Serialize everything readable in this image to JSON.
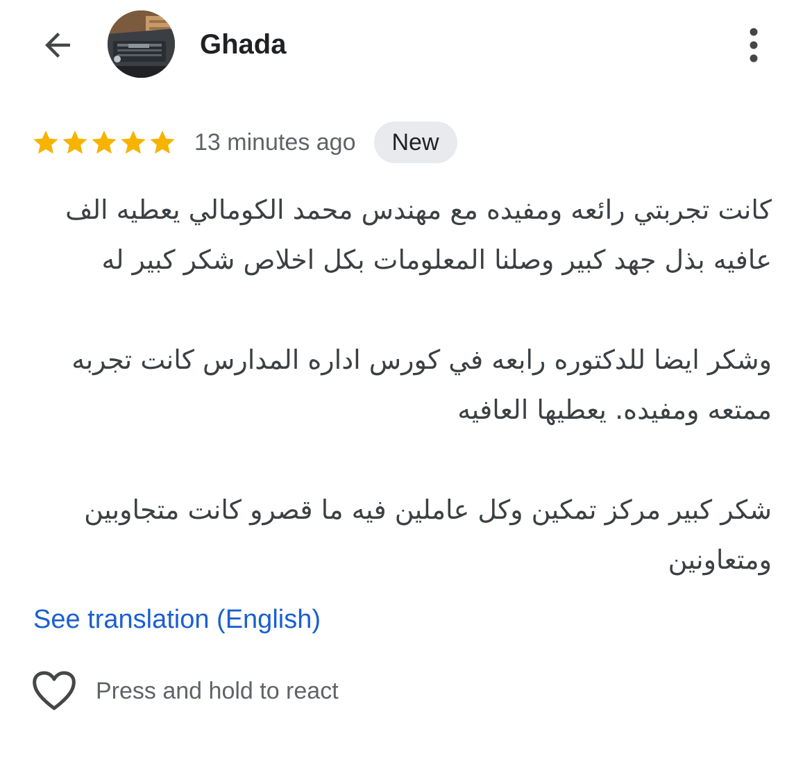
{
  "header": {
    "back_icon": "arrow-left-icon",
    "user_name": "Ghada",
    "more_icon": "more-vertical-icon"
  },
  "review": {
    "rating": 5,
    "rating_max": 5,
    "star_color": "#f6b400",
    "timestamp": "13 minutes ago",
    "badge": "New",
    "paragraphs": [
      "كانت تجربتي رائعه ومفيده مع مهندس محمد الكومالي يعطيه الف عافيه بذل جهد كبير وصلنا المعلومات بكل اخلاص شكر كبير له",
      "وشكر ايضا للدكتوره رابعه في كورس اداره المدارس كانت تجربه ممتعه ومفيده. يعطيها العافيه",
      "شكر كبير مركز تمكين وكل عاملين فيه ما قصرو كانت متجاوبين ومتعاونين"
    ],
    "translate_link": "See translation (English)",
    "link_color": "#1a5fd0"
  },
  "reaction": {
    "heart_icon": "heart-outline-icon",
    "hint": "Press and hold to react"
  }
}
